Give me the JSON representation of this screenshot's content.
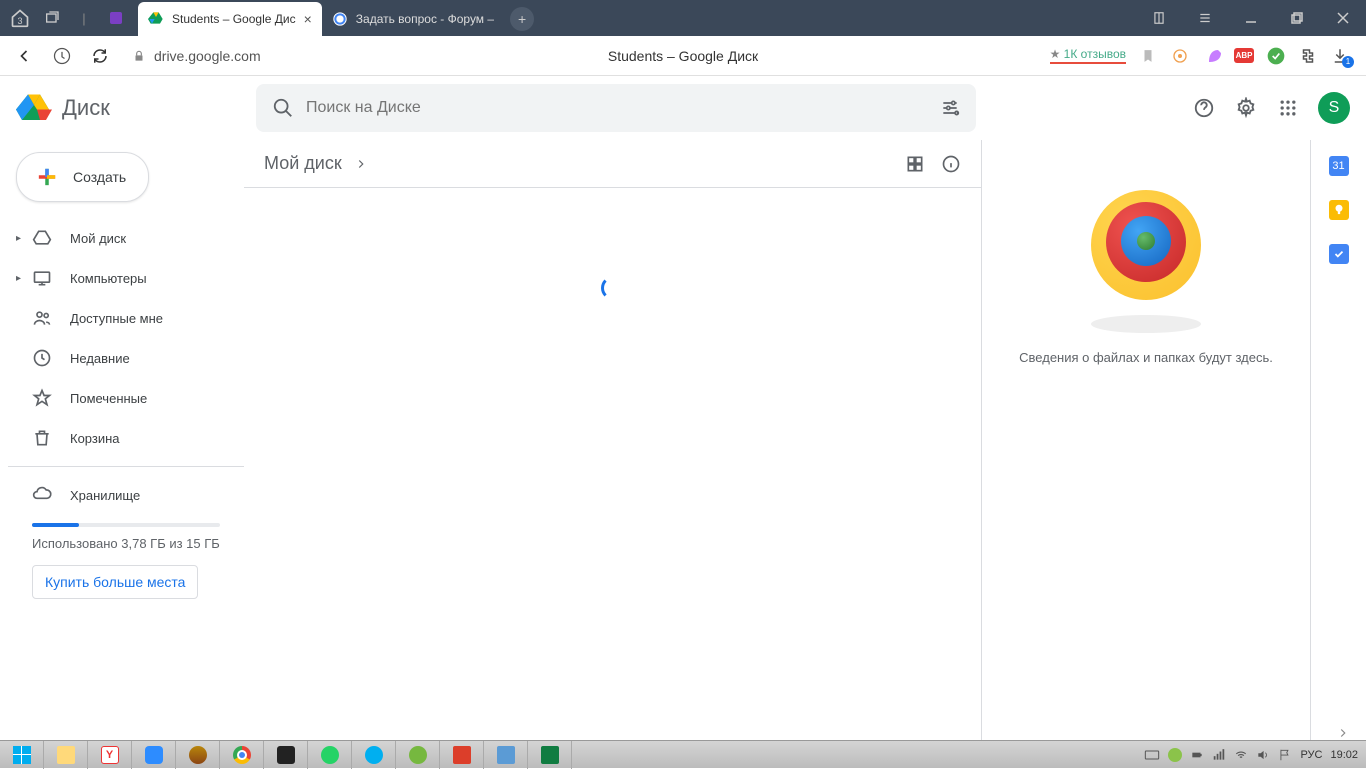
{
  "titlebar": {
    "home_badge": "3",
    "tabs": [
      {
        "title": "Students – Google Дис",
        "active": true
      },
      {
        "title": "Задать вопрос - Форум –",
        "active": false
      }
    ]
  },
  "addressbar": {
    "url": "drive.google.com",
    "page_title": "Students – Google Диск",
    "reviews": "1К отзывов",
    "abp_label": "ABP"
  },
  "drive": {
    "logo_text": "Диск",
    "search_placeholder": "Поиск на Диске",
    "avatar_letter": "S"
  },
  "sidebar": {
    "create_label": "Создать",
    "items": [
      {
        "label": "Мой диск",
        "expandable": true
      },
      {
        "label": "Компьютеры",
        "expandable": true
      },
      {
        "label": "Доступные мне",
        "expandable": false
      },
      {
        "label": "Недавние",
        "expandable": false
      },
      {
        "label": "Помеченные",
        "expandable": false
      },
      {
        "label": "Корзина",
        "expandable": false
      }
    ],
    "storage_label": "Хранилище",
    "storage_used_text": "Использовано 3,78 ГБ из 15 ГБ",
    "storage_percent": 25,
    "buy_more": "Купить больше места"
  },
  "breadcrumb": {
    "current": "Мой диск"
  },
  "details": {
    "empty_text": "Сведения о файлах и папках будут здесь."
  },
  "rail": {
    "calendar_day": "31"
  },
  "taskbar": {
    "lang": "РУС",
    "time": "19:02"
  }
}
